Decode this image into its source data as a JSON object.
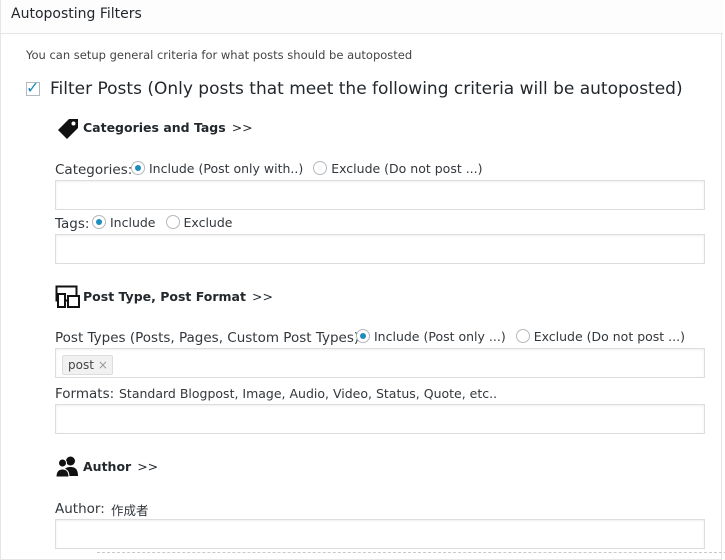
{
  "panel": {
    "title": "Autoposting Filters",
    "intro": "You can setup general criteria for what posts should be autoposted"
  },
  "filter": {
    "checked": true,
    "label": "Filter Posts (Only posts that meet the following criteria will be autoposted)"
  },
  "sections": {
    "categories_tags": {
      "icon": "tag-icon",
      "title": "Categories and Tags",
      "arrows": ">>"
    },
    "post_type": {
      "icon": "devices-icon",
      "title": "Post Type, Post Format",
      "arrows": ">>"
    },
    "author": {
      "icon": "users-icon",
      "title": "Author",
      "arrows": ">>"
    }
  },
  "categories": {
    "label": "Categories:",
    "include_label": "Include (Post only with..)",
    "exclude_label": "Exclude (Do not post ...)",
    "selected": "include",
    "value": ""
  },
  "tags": {
    "label": "Tags:",
    "include_label": "Include",
    "exclude_label": "Exclude",
    "selected": "include",
    "value": ""
  },
  "post_types": {
    "label": "Post Types (Posts, Pages, Custom Post Types):",
    "include_label": "Include (Post only ...)",
    "exclude_label": "Exclude (Do not post ...)",
    "selected": "include",
    "chips": [
      "post"
    ],
    "chip_remove": "×"
  },
  "formats": {
    "label": "Formats:",
    "hint": "Standard Blogpost, Image, Audio, Video, Status, Quote, etc..",
    "value": ""
  },
  "author": {
    "label": "Author:",
    "hint": "作成者",
    "value": ""
  },
  "colors": {
    "accent": "#1e8cbe",
    "border": "#dddddd",
    "text": "#32373c"
  }
}
